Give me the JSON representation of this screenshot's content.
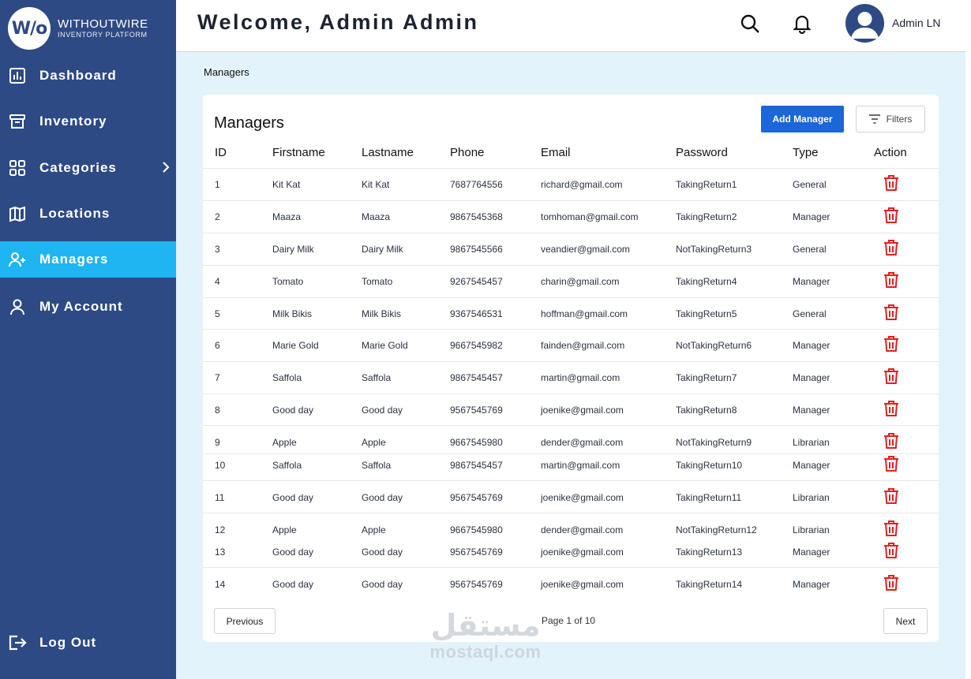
{
  "brand": {
    "logo_mark": "W/o",
    "name": "WITHOUTWIRE",
    "tagline": "INVENTORY PLATFORM"
  },
  "nav": {
    "items": [
      {
        "label": "Dashboard",
        "icon": "bar-chart-icon"
      },
      {
        "label": "Inventory",
        "icon": "archive-icon"
      },
      {
        "label": "Categories",
        "icon": "grid-icon"
      },
      {
        "label": "Locations",
        "icon": "map-icon"
      },
      {
        "label": "Managers",
        "icon": "user-plus-icon",
        "active": true
      },
      {
        "label": "My Account",
        "icon": "user-icon"
      }
    ],
    "logout": "Log Out"
  },
  "header": {
    "welcome": "Welcome, Admin Admin",
    "user_name": "Admin LN"
  },
  "breadcrumb": "Managers",
  "table": {
    "title": "Managers",
    "add_label": "Add Manager",
    "filter_label": "Filters",
    "columns": [
      "ID",
      "Firstname",
      "Lastname",
      "Phone",
      "Email",
      "Password",
      "Type",
      "Action"
    ],
    "rows": [
      {
        "id": "1",
        "firstname": "Kit Kat",
        "lastname": "Kit Kat",
        "phone": "7687764556",
        "email": "richard@gmail.com",
        "password": "TakingReturn1",
        "type": "General"
      },
      {
        "id": "2",
        "firstname": "Maaza",
        "lastname": "Maaza",
        "phone": "9867545368",
        "email": "tomhoman@gmail.com",
        "password": "TakingReturn2",
        "type": "Manager"
      },
      {
        "id": "3",
        "firstname": "Dairy Milk",
        "lastname": "Dairy Milk",
        "phone": "9867545566",
        "email": "veandier@gmail.com",
        "password": "NotTakingReturn3",
        "type": "General"
      },
      {
        "id": "4",
        "firstname": "Tomato",
        "lastname": "Tomato",
        "phone": "9267545457",
        "email": "charin@gmail.com",
        "password": "TakingReturn4",
        "type": "Manager"
      },
      {
        "id": "5",
        "firstname": "Milk Bikis",
        "lastname": "Milk Bikis",
        "phone": "9367546531",
        "email": "hoffman@gmail.com",
        "password": "TakingReturn5",
        "type": "General"
      },
      {
        "id": "6",
        "firstname": "Marie Gold",
        "lastname": "Marie Gold",
        "phone": "9667545982",
        "email": "fainden@gmail.com",
        "password": "NotTakingReturn6",
        "type": "Manager"
      },
      {
        "id": "7",
        "firstname": "Saffola",
        "lastname": "Saffola",
        "phone": "9867545457",
        "email": "martin@gmail.com",
        "password": "TakingReturn7",
        "type": "Manager"
      },
      {
        "id": "8",
        "firstname": "Good day",
        "lastname": "Good day",
        "phone": "9567545769",
        "email": "joenike@gmail.com",
        "password": "TakingReturn8",
        "type": "Manager"
      },
      {
        "id": "9",
        "firstname": "Apple",
        "lastname": "Apple",
        "phone": "9667545980",
        "email": "dender@gmail.com",
        "password": "NotTakingReturn9",
        "type": "Librarian"
      },
      {
        "id": "10",
        "firstname": "Saffola",
        "lastname": "Saffola",
        "phone": "9867545457",
        "email": "martin@gmail.com",
        "password": "TakingReturn10",
        "type": "Manager"
      },
      {
        "id": "11",
        "firstname": "Good day",
        "lastname": "Good day",
        "phone": "9567545769",
        "email": "joenike@gmail.com",
        "password": "TakingReturn11",
        "type": "Librarian"
      },
      {
        "id": "12",
        "firstname": "Apple",
        "lastname": "Apple",
        "phone": "9667545980",
        "email": "dender@gmail.com",
        "password": "NotTakingReturn12",
        "type": "Librarian"
      },
      {
        "id": "13",
        "firstname": "Good day",
        "lastname": "Good day",
        "phone": "9567545769",
        "email": "joenike@gmail.com",
        "password": "TakingReturn13",
        "type": "Manager"
      },
      {
        "id": "14",
        "firstname": "Good day",
        "lastname": "Good day",
        "phone": "9567545769",
        "email": "joenike@gmail.com",
        "password": "TakingReturn14",
        "type": "Manager"
      }
    ]
  },
  "pagination": {
    "previous": "Previous",
    "next": "Next",
    "info": "Page 1 of 10"
  },
  "watermark": {
    "arabic": "مستقل",
    "latin": "mostaql.com"
  },
  "colors": {
    "sidebar": "#2e4a84",
    "active": "#1fb4f2",
    "primary_button": "#1b66d8",
    "delete": "#e02020",
    "page_bg": "#e3f3fb"
  }
}
